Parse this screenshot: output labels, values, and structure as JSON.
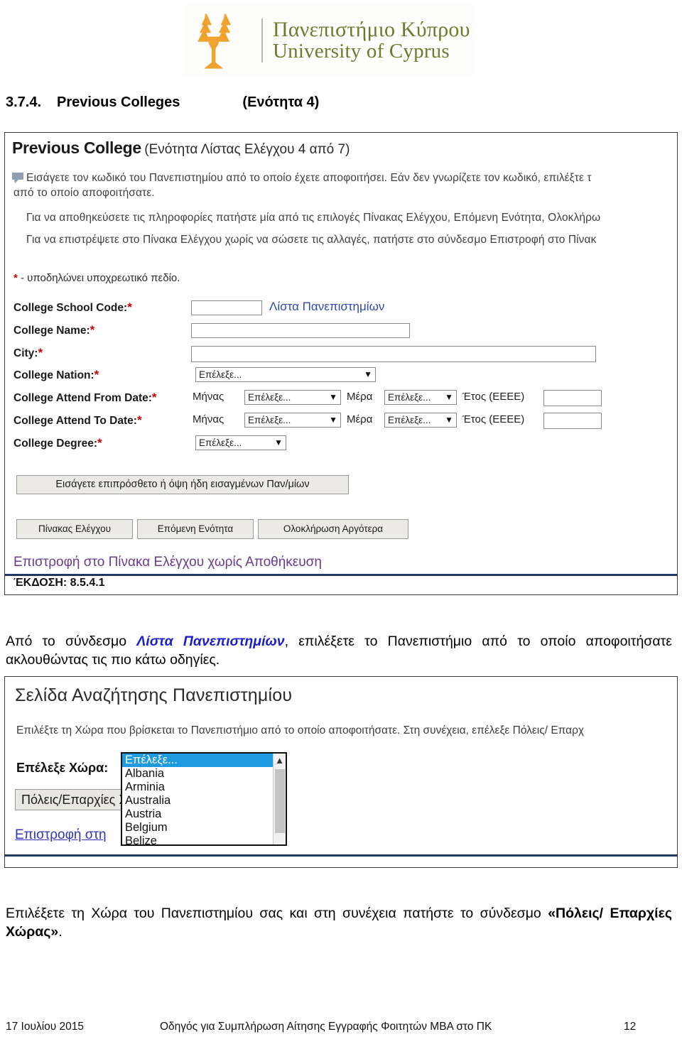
{
  "logo": {
    "greek_name": "Πανεπιστήμιο Κύπρου",
    "english_name": "University of Cyprus",
    "icon": "ucy-tree-logo"
  },
  "section_heading": {
    "number": "3.7.4.",
    "title": "Previous Colleges",
    "parenthetical": "(Ενότητα 4)"
  },
  "screenshot_form": {
    "title_bold": "Previous College",
    "title_rest": "(Ενότητα Λίστας Ελέγχου 4 από 7)",
    "instructions": [
      "Εισάγετε τον κωδικό του Πανεπιστημίου από το οποίο έχετε αποφοιτήσει. Εάν δεν γνωρίζετε τον κωδικό, επιλέξτε τ",
      "από το οποίο αποφοιτήσατε.",
      "Για να αποθηκεύσετε τις πληροφορίες πατήστε μία από τις επιλογές Πίνακας Ελέγχου, Επόμενη Ενότητα, Ολοκλήρω",
      "Για να επιστρέψετε στο Πίνακα Ελέγχου χωρίς να σώσετε τις αλλαγές, πατήστε στο σύνδεσμο Επιστροφή στο Πίνακ"
    ],
    "required_note": "- υποδηλώνει υποχρεωτικό πεδίο.",
    "required_marker": "*",
    "fields": [
      {
        "label": "College School Code:",
        "required": true,
        "control": "text",
        "value": ""
      },
      {
        "label": "College Name:",
        "required": true,
        "control": "text",
        "value": ""
      },
      {
        "label": "City:",
        "required": true,
        "control": "text",
        "value": ""
      },
      {
        "label": "College Nation:",
        "required": true,
        "control": "select",
        "value": "Επέλεξε..."
      },
      {
        "label": "College Attend From Date:",
        "required": true,
        "control": "date"
      },
      {
        "label": "College Attend To Date:",
        "required": true,
        "control": "date"
      },
      {
        "label": "College Degree:",
        "required": true,
        "control": "select",
        "value": "Επέλεξε..."
      }
    ],
    "school_code_link": "Λίστα Πανεπιστημίων",
    "date_parts": {
      "month_label": "Μήνας",
      "month_value": "Επέλεξε...",
      "day_label": "Μέρα",
      "day_value": "Επέλεξε...",
      "year_label": "Έτος (ΕΕΕΕ)",
      "year_value": ""
    },
    "add_more_button": "Εισάγετε επιπρόσθετο ή όψη ήδη εισαγμένων Παν/μίων",
    "buttons": [
      "Πίνακας Ελέγχου",
      "Επόμενη Ενότητα",
      "Ολοκλήρωση Αργότερα"
    ],
    "return_link": "Επιστροφή στο Πίνακα Ελέγχου χωρίς Αποθήκευση",
    "version": "ΈΚΔΟΣΗ: 8.5.4.1"
  },
  "middle_paragraph": {
    "before": "Από το σύνδεσμο ",
    "link": "Λίστα Πανεπιστημίων",
    "after": ", επιλέξετε το Πανεπιστήμιο από το οποίο αποφοιτήσατε ακλουθώντας τις πιο κάτω οδηγίες."
  },
  "screenshot_search": {
    "title": "Σελίδα Αναζήτησης Πανεπιστημίου",
    "instruction": "Επιλέξτε τη Χώρα που βρίσκεται το Πανεπιστήμιο από το οποίο αποφοιτήσατε. Στη συνέχεια, επέλεξε Πόλεις/ Επαρχ",
    "country_label": "Επέλεξε Χώρα:",
    "dropdown_options": [
      "Επέλεξε...",
      "Albania",
      "Arminia",
      "Australia",
      "Austria",
      "Belgium",
      "Belize"
    ],
    "dropdown_selected_index": 0,
    "cities_button": "Πόλεις/Επαρχίες Χώρας",
    "back_link": "Επιστροφή στη"
  },
  "bottom_paragraph": {
    "text_before": "Επιλέξετε τη Χώρα του Πανεπιστημίου σας και στη συνέχεια πατήστε το σύνδεσμο ",
    "bold_text": "«Πόλεις/ Επαρχίες Χώρας»",
    "text_after": "."
  },
  "footer": {
    "date": "17 Ιουλίου 2015",
    "title": "Οδηγός  για Συμπλήρωση Αίτησης Εγγραφής Φοιτητών ΜΒΑ στο ΠΚ",
    "page": "12"
  },
  "colors": {
    "logo_green": "#6f7a2e",
    "logo_orange": "#f0a32e",
    "required_red": "#cc0000",
    "link_blue": "#2f48b8",
    "link_purple": "#6b3b8f",
    "rule_navy": "#1f3864",
    "highlight_blue": "#1e9ae0"
  }
}
